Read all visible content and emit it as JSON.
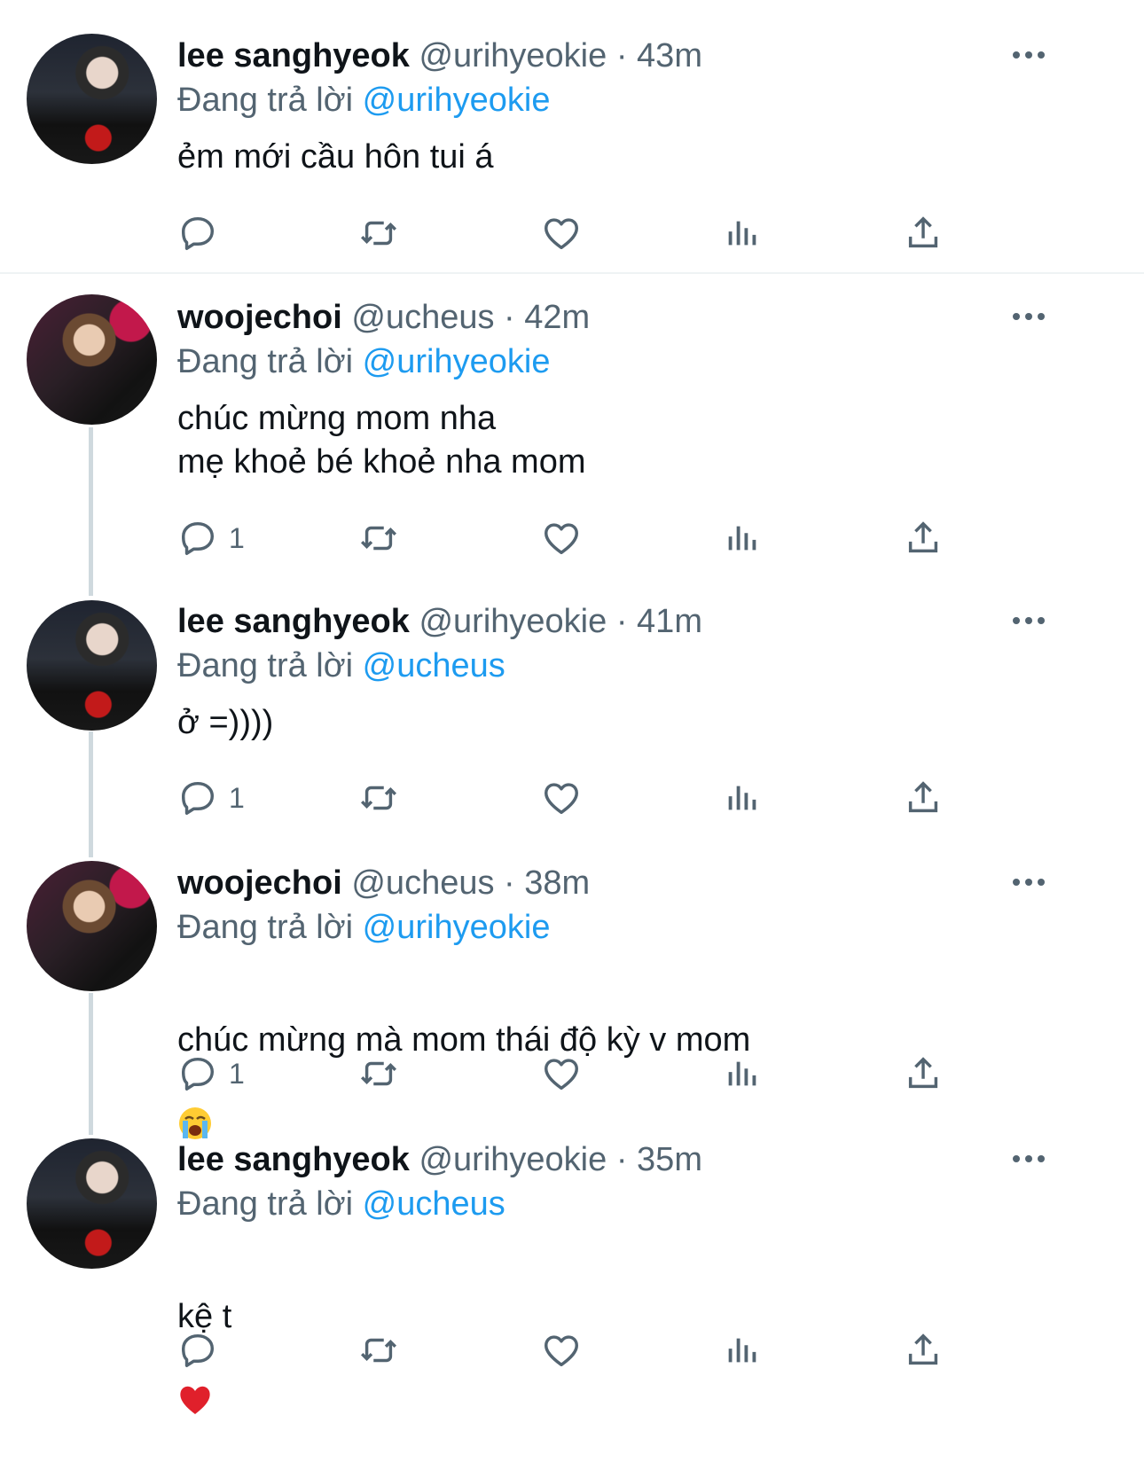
{
  "tweets": [
    {
      "name": "lee sanghyeok",
      "handle": "@urihyeokie",
      "sep": "·",
      "time": "43m",
      "reply_prefix": "Đang trả lời",
      "reply_to": "@urihyeokie",
      "text": "ẻm mới cầu hôn tui á",
      "reply_count": "",
      "avatar": "lee"
    },
    {
      "name": "woojechoi",
      "handle": "@ucheus",
      "sep": "·",
      "time": "42m",
      "reply_prefix": "Đang trả lời",
      "reply_to": "@urihyeokie",
      "text": "chúc mừng mom nha\nmẹ khoẻ bé khoẻ nha mom",
      "reply_count": "1",
      "avatar": "woo"
    },
    {
      "name": "lee sanghyeok",
      "handle": "@urihyeokie",
      "sep": "·",
      "time": "41m",
      "reply_prefix": "Đang trả lời",
      "reply_to": "@ucheus",
      "text": "ở =))))",
      "reply_count": "1",
      "avatar": "lee"
    },
    {
      "name": "woojechoi",
      "handle": "@ucheus",
      "sep": "·",
      "time": "38m",
      "reply_prefix": "Đang trả lời",
      "reply_to": "@urihyeokie",
      "text": "chúc mừng mà mom thái độ kỳ v mom",
      "emoji": "loudly-crying-face",
      "reply_count": "1",
      "avatar": "woo"
    },
    {
      "name": "lee sanghyeok",
      "handle": "@urihyeokie",
      "sep": "·",
      "time": "35m",
      "reply_prefix": "Đang trả lời",
      "reply_to": "@ucheus",
      "text": "kệ t",
      "emoji": "red-heart",
      "reply_count": "",
      "avatar": "lee"
    }
  ],
  "icons": {
    "reply": "reply-icon",
    "retweet": "retweet-icon",
    "like": "like-icon",
    "views": "views-icon",
    "share": "share-icon",
    "more": "more-icon"
  },
  "colors": {
    "link": "#1d9bf0",
    "secondary": "#536471",
    "text": "#0f1419",
    "line": "#cfd9de"
  }
}
